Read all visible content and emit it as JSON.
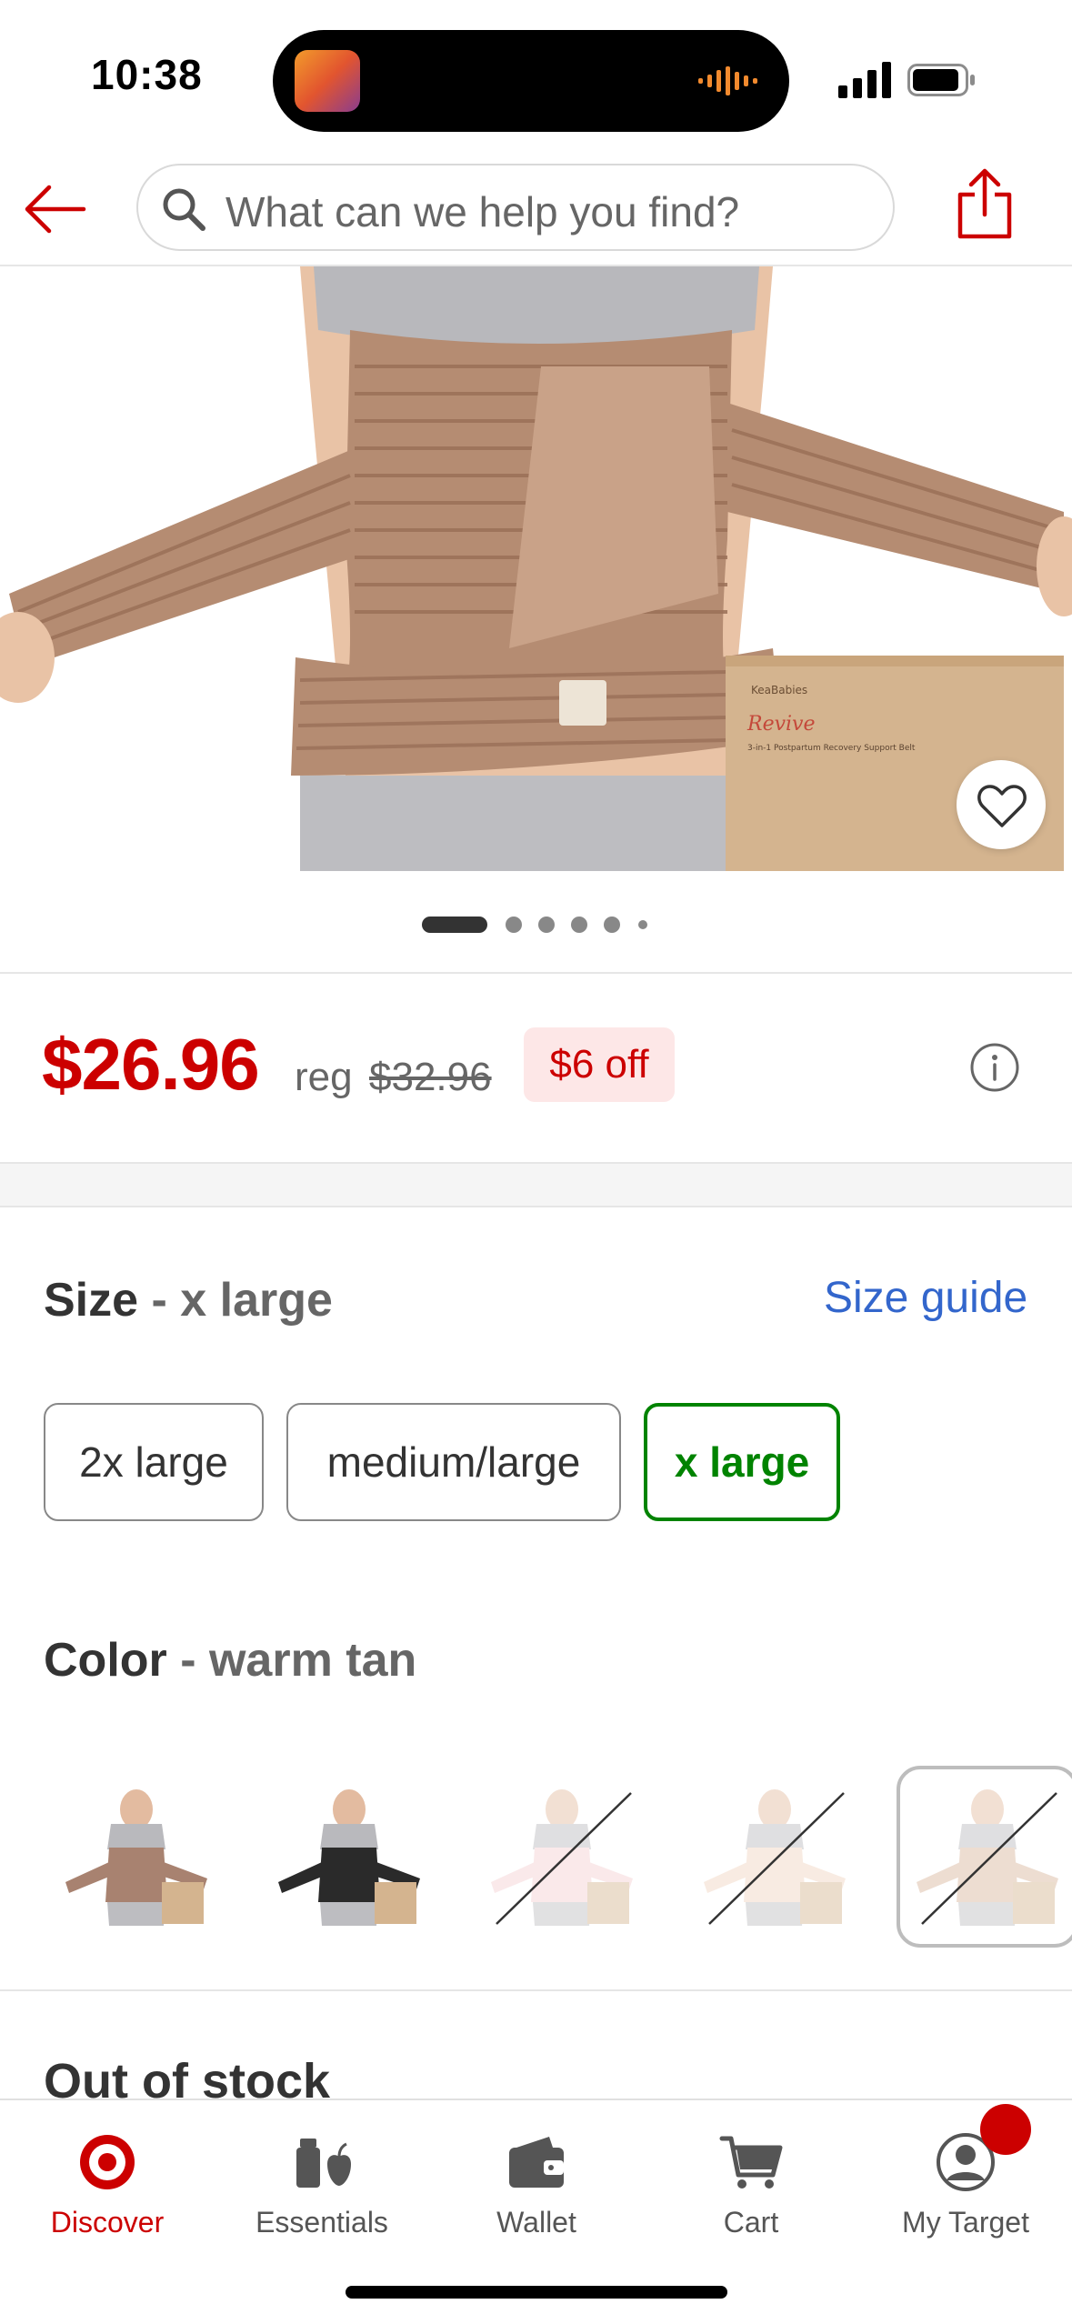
{
  "status_bar": {
    "time": "10:38"
  },
  "header": {
    "search_placeholder": "What can we help you find?"
  },
  "gallery": {
    "total_images": 6,
    "active_index": 0
  },
  "price": {
    "current": "$26.96",
    "reg_label": "reg",
    "reg_value": "$32.96",
    "discount": "$6 off"
  },
  "size": {
    "label": "Size",
    "separator": " - ",
    "selected": "x large",
    "guide_label": "Size guide",
    "options": [
      {
        "label": "2x large"
      },
      {
        "label": "medium/large"
      },
      {
        "label": "x large",
        "selected": true
      }
    ]
  },
  "color": {
    "label": "Color",
    "separator": " - ",
    "selected": "warm tan",
    "swatches": [
      {
        "tone": "#a88270",
        "available": true
      },
      {
        "tone": "#2a2a2a",
        "available": true
      },
      {
        "tone": "#f4cfd2",
        "available": false
      },
      {
        "tone": "#f1d5bf",
        "available": false
      },
      {
        "tone": "#d9b49a",
        "available": false,
        "selected": true
      }
    ]
  },
  "stock_status": "Out of stock",
  "tab_bar": {
    "items": [
      {
        "label": "Discover",
        "icon": "target-logo-icon",
        "active": true
      },
      {
        "label": "Essentials",
        "icon": "essentials-icon"
      },
      {
        "label": "Wallet",
        "icon": "wallet-icon"
      },
      {
        "label": "Cart",
        "icon": "cart-icon"
      },
      {
        "label": "My Target",
        "icon": "profile-icon",
        "has_notification": true
      }
    ]
  },
  "colors": {
    "brand_red": "#cc0000",
    "selected_green": "#008300",
    "link_blue": "#3366cc"
  }
}
